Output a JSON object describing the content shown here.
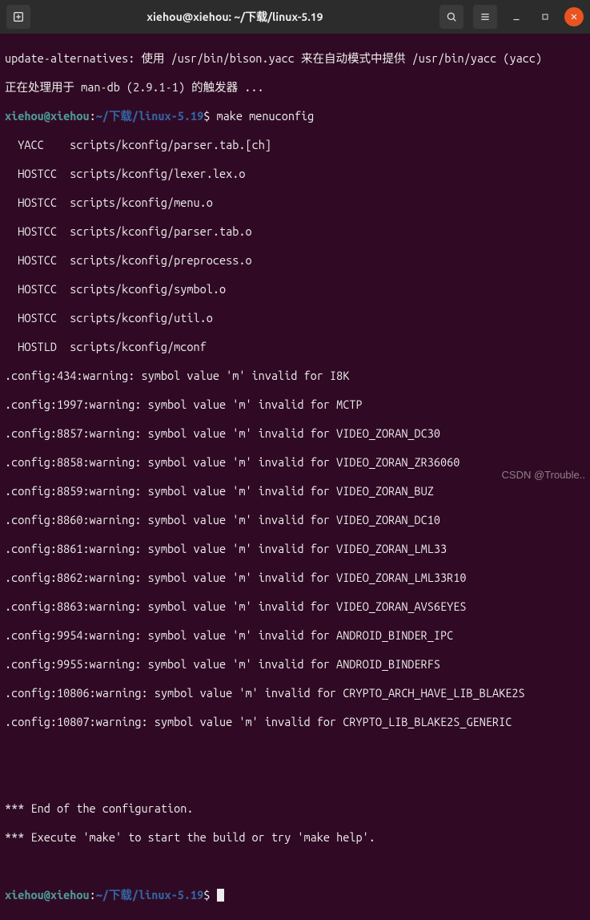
{
  "titlebar": {
    "title": "xiehou@xiehou: ~/下载/linux-5.19"
  },
  "prompt": {
    "user_host": "xiehou@xiehou",
    "sep1": ":",
    "path": "~/下载/linux-5.19",
    "sep2": "$"
  },
  "cmd": {
    "make": " make menuconfig"
  },
  "lines": {
    "l0": "update-alternatives: 使用 /usr/bin/bison.yacc 来在自动模式中提供 /usr/bin/yacc (yacc)",
    "l1": "正在处理用于 man-db (2.9.1-1) 的触发器 ...",
    "yacc": "  YACC    scripts/kconfig/parser.tab.[ch]",
    "hc1": "  HOSTCC  scripts/kconfig/lexer.lex.o",
    "hc2": "  HOSTCC  scripts/kconfig/menu.o",
    "hc3": "  HOSTCC  scripts/kconfig/parser.tab.o",
    "hc4": "  HOSTCC  scripts/kconfig/preprocess.o",
    "hc5": "  HOSTCC  scripts/kconfig/symbol.o",
    "hc6": "  HOSTCC  scripts/kconfig/util.o",
    "hld": "  HOSTLD  scripts/kconfig/mconf",
    "w434": ".config:434:warning: symbol value 'm' invalid for I8K",
    "w1997": ".config:1997:warning: symbol value 'm' invalid for MCTP",
    "w8857": ".config:8857:warning: symbol value 'm' invalid for VIDEO_ZORAN_DC30",
    "w8858": ".config:8858:warning: symbol value 'm' invalid for VIDEO_ZORAN_ZR36060",
    "w8859": ".config:8859:warning: symbol value 'm' invalid for VIDEO_ZORAN_BUZ",
    "w8860": ".config:8860:warning: symbol value 'm' invalid for VIDEO_ZORAN_DC10",
    "w8861": ".config:8861:warning: symbol value 'm' invalid for VIDEO_ZORAN_LML33",
    "w8862": ".config:8862:warning: symbol value 'm' invalid for VIDEO_ZORAN_LML33R10",
    "w8863": ".config:8863:warning: symbol value 'm' invalid for VIDEO_ZORAN_AVS6EYES",
    "w9954": ".config:9954:warning: symbol value 'm' invalid for ANDROID_BINDER_IPC",
    "w9955": ".config:9955:warning: symbol value 'm' invalid for ANDROID_BINDERFS",
    "w10806": ".config:10806:warning: symbol value 'm' invalid for CRYPTO_ARCH_HAVE_LIB_BLAKE2S",
    "w10807": ".config:10807:warning: symbol value 'm' invalid for CRYPTO_LIB_BLAKE2S_GENERIC",
    "end1": "*** End of the configuration.",
    "end2": "*** Execute 'make' to start the build or try 'make help'."
  },
  "watermark": "CSDN @Trouble.."
}
